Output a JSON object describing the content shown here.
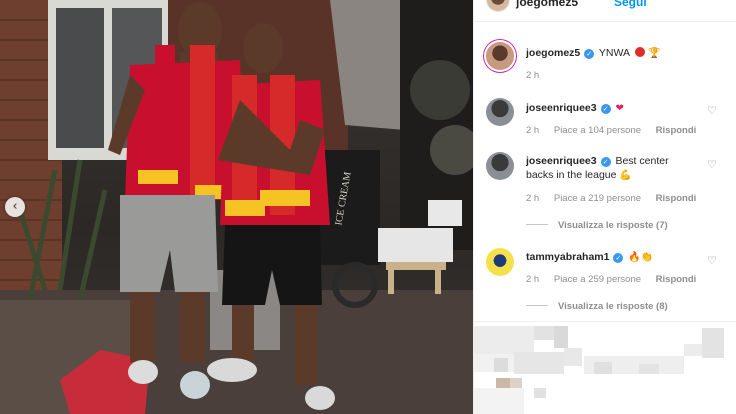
{
  "post": {
    "header_username": "joegomez5",
    "header_follow": "Segui",
    "caption": {
      "username": "joegomez5",
      "text": "YNWA",
      "emojis": [
        "red-circle",
        "trophy"
      ],
      "time": "2 h"
    }
  },
  "comments": [
    {
      "username": "joseenriquee3",
      "text": "",
      "emoji_glyph": "❤",
      "time": "2 h",
      "likes": "Piace a 104 persone",
      "reply": "Rispondi",
      "view_replies": ""
    },
    {
      "username": "joseenriquee3",
      "text": "Best center backs in the league",
      "emoji_glyph": "💪",
      "time": "2 h",
      "likes": "Piace a 219 persone",
      "reply": "Rispondi",
      "view_replies": "Visualizza le risposte (7)"
    },
    {
      "username": "tammyabraham1",
      "text": "",
      "emoji_glyph": "🔥👏",
      "time": "2 h",
      "likes": "Piace a 259 persone",
      "reply": "Rispondi",
      "view_replies": "Visualizza le risposte (8)"
    }
  ],
  "colors": {
    "accent_blue": "#0095f6",
    "verified_blue": "#3897f0",
    "muted_text": "#8e8e8e",
    "liverpool_red": "#c8102e",
    "scarf_yellow": "#f6c324"
  },
  "icons": [
    "verified-badge-icon",
    "heart-icon",
    "chevron-left-icon",
    "red-heart-emoji",
    "flexed-biceps-emoji",
    "fire-emoji",
    "clapping-hands-emoji",
    "red-circle-emoji",
    "trophy-emoji"
  ],
  "photo": {
    "sign_text": "ICE CREAM"
  }
}
